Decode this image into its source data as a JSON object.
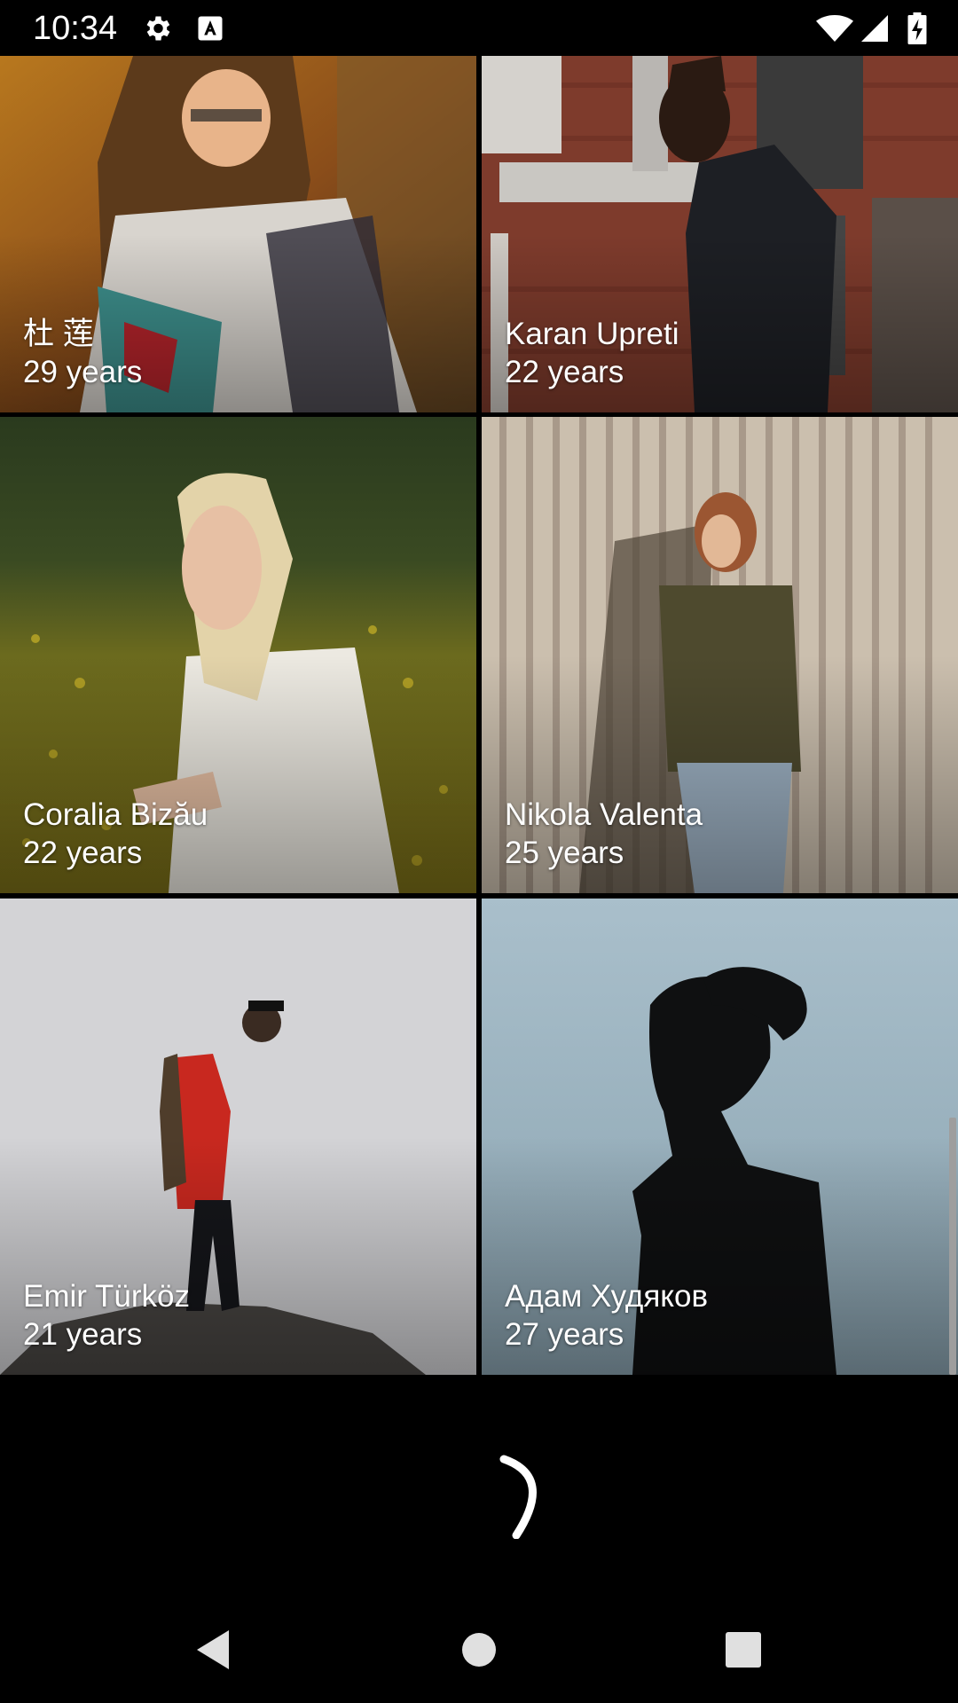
{
  "status_bar": {
    "time": "10:34",
    "icons": [
      "gear-icon",
      "text-a-icon",
      "wifi-icon",
      "signal-icon",
      "battery-charging-icon"
    ]
  },
  "profiles": [
    {
      "name": "杜 莲",
      "age": "29 years",
      "photo": "portrait-woman-sunset-blanket"
    },
    {
      "name": "Karan Upreti",
      "age": "22 years",
      "photo": "man-leather-jacket-brick-building"
    },
    {
      "name": "Coralia Bizău",
      "age": "22 years",
      "photo": "blonde-woman-yellow-flower-field"
    },
    {
      "name": "Nikola Valenta",
      "age": "25 years",
      "photo": "redhead-woman-wooden-wall"
    },
    {
      "name": "Emir Türköz",
      "age": "21 years",
      "photo": "hiker-red-jacket-on-rock"
    },
    {
      "name": "Адам Худяков",
      "age": "27 years",
      "photo": "silhouette-man-sky"
    }
  ],
  "loading": {
    "icon": "loading-spinner-icon"
  },
  "navigation": {
    "buttons": [
      "back-icon",
      "home-icon",
      "recents-icon"
    ],
    "color": "#e0e0e0"
  },
  "colors": {
    "background": "#000000",
    "text": "#ffffff"
  }
}
